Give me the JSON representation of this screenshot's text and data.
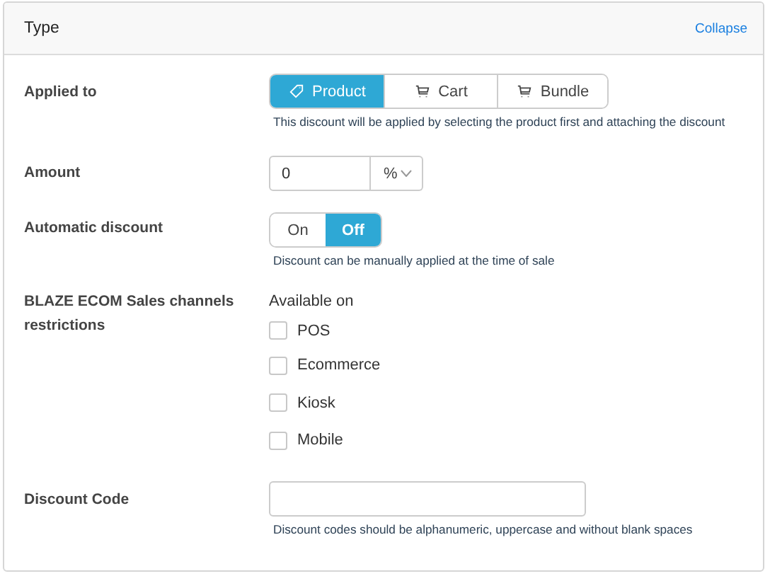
{
  "panel": {
    "title": "Type",
    "collapse_link": "Collapse"
  },
  "applied_to": {
    "label": "Applied to",
    "options": [
      {
        "label": "Product",
        "selected": true
      },
      {
        "label": "Cart",
        "selected": false
      },
      {
        "label": "Bundle",
        "selected": false
      }
    ],
    "help": "This discount will be applied by selecting the product first and attaching the discount"
  },
  "amount": {
    "label": "Amount",
    "value": "0",
    "unit": "%"
  },
  "automatic_discount": {
    "label": "Automatic discount",
    "options": [
      {
        "label": "On",
        "selected": false
      },
      {
        "label": "Off",
        "selected": true
      }
    ],
    "help": "Discount can be manually applied at the time of sale"
  },
  "sales_channels": {
    "label": "BLAZE ECOM Sales channels restrictions",
    "heading": "Available on",
    "channels": [
      {
        "label": "POS",
        "checked": false
      },
      {
        "label": "Ecommerce",
        "checked": false
      },
      {
        "label": "Kiosk",
        "checked": false
      },
      {
        "label": "Mobile",
        "checked": false
      }
    ]
  },
  "discount_code": {
    "label": "Discount Code",
    "help": "Discount codes should be alphanumeric, uppercase and without blank spaces"
  }
}
